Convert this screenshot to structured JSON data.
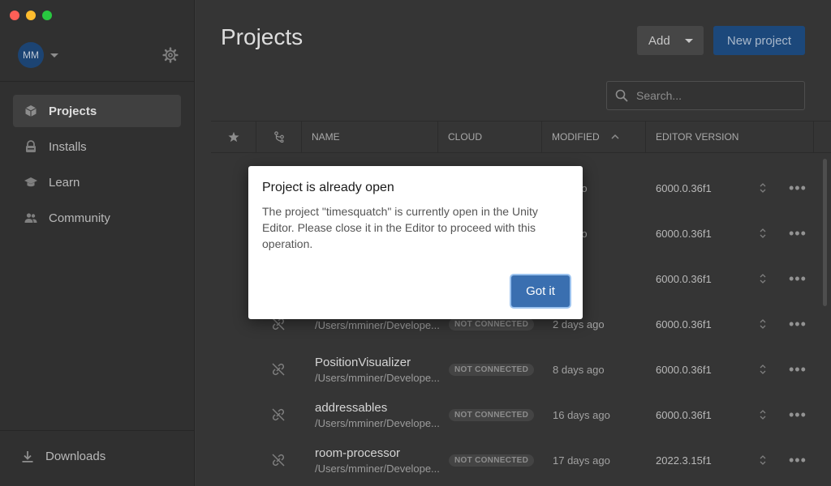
{
  "window": {
    "controls": [
      "close",
      "minimize",
      "maximize"
    ]
  },
  "sidebar": {
    "avatar_initials": "MM",
    "items": [
      {
        "label": "Projects",
        "icon": "cube-icon",
        "active": true
      },
      {
        "label": "Installs",
        "icon": "lock-icon",
        "active": false
      },
      {
        "label": "Learn",
        "icon": "graduation-cap-icon",
        "active": false
      },
      {
        "label": "Community",
        "icon": "people-icon",
        "active": false
      }
    ],
    "downloads_label": "Downloads"
  },
  "header": {
    "title": "Projects",
    "add_label": "Add",
    "new_project_label": "New project",
    "search_placeholder": "Search..."
  },
  "table": {
    "columns": [
      "NAME",
      "CLOUD",
      "MODIFIED",
      "EDITOR VERSION"
    ],
    "sort_column": "MODIFIED",
    "rows": [
      {
        "name": "",
        "path": "",
        "cloud": "",
        "modified": "tes ago",
        "version": "6000.0.36f1"
      },
      {
        "name": "",
        "path": "",
        "cloud": "",
        "modified": "tes ago",
        "version": "6000.0.36f1"
      },
      {
        "name": "",
        "path": "",
        "cloud": "",
        "modified": "ago",
        "version": "6000.0.36f1"
      },
      {
        "name": "",
        "path": "/Users/mminer/Develope...",
        "cloud": "NOT CONNECTED",
        "modified": "2 days ago",
        "version": "6000.0.36f1"
      },
      {
        "name": "PositionVisualizer",
        "path": "/Users/mminer/Develope...",
        "cloud": "NOT CONNECTED",
        "modified": "8 days ago",
        "version": "6000.0.36f1"
      },
      {
        "name": "addressables",
        "path": "/Users/mminer/Develope...",
        "cloud": "NOT CONNECTED",
        "modified": "16 days ago",
        "version": "6000.0.36f1"
      },
      {
        "name": "room-processor",
        "path": "/Users/mminer/Develope...",
        "cloud": "NOT CONNECTED",
        "modified": "17 days ago",
        "version": "2022.3.15f1"
      }
    ]
  },
  "dialog": {
    "title": "Project is already open",
    "message": "The project \"timesquatch\" is currently open in the Unity Editor. Please close it in the Editor to proceed with this operation.",
    "button_label": "Got it"
  },
  "colors": {
    "accent": "#1f4f86",
    "dialog_button": "#3a6fb0"
  }
}
